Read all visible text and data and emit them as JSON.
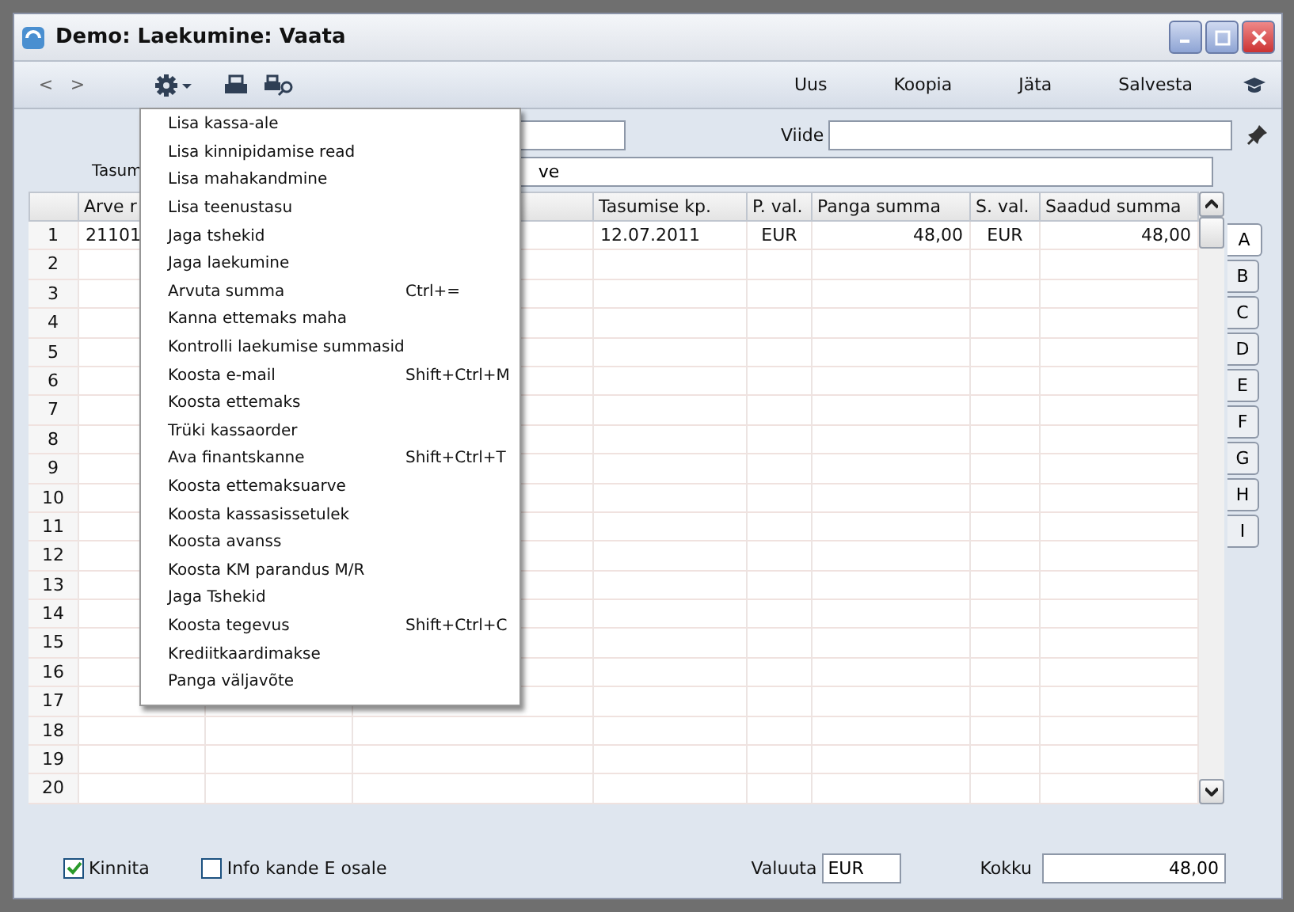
{
  "window": {
    "title": "Demo: Laekumine: Vaata"
  },
  "toolbar": {
    "nav": [
      "<",
      ">"
    ],
    "actions": [
      "Uus",
      "Koopia",
      "Jäta",
      "Salvesta"
    ]
  },
  "form": {
    "reference": {
      "label": "Viide"
    },
    "payment_label": "Tasum",
    "payment_field": {
      "value": "ve"
    }
  },
  "table": {
    "columns": [
      "",
      "Arve r",
      "",
      "",
      "Tasumise kp.",
      "P. val.",
      "Panga summa",
      "S. val.",
      "Saadud summa"
    ],
    "rows": [
      {
        "cells": [
          "1",
          "21101",
          "",
          "",
          "12.07.2011",
          "EUR",
          "48,00",
          "EUR",
          "48,00"
        ]
      },
      {
        "cells": [
          "2"
        ]
      },
      {
        "cells": [
          "3"
        ]
      },
      {
        "cells": [
          "4"
        ]
      },
      {
        "cells": [
          "5"
        ]
      },
      {
        "cells": [
          "6"
        ]
      },
      {
        "cells": [
          "7"
        ]
      },
      {
        "cells": [
          "8"
        ]
      },
      {
        "cells": [
          "9"
        ]
      },
      {
        "cells": [
          "10"
        ]
      },
      {
        "cells": [
          "11"
        ]
      },
      {
        "cells": [
          "12"
        ]
      },
      {
        "cells": [
          "13"
        ]
      },
      {
        "cells": [
          "14"
        ]
      },
      {
        "cells": [
          "15"
        ]
      },
      {
        "cells": [
          "16"
        ]
      },
      {
        "cells": [
          "17"
        ]
      },
      {
        "cells": [
          "18"
        ]
      },
      {
        "cells": [
          "19"
        ]
      },
      {
        "cells": [
          "20"
        ]
      }
    ]
  },
  "side_tabs": [
    {
      "label": "A",
      "selected": true
    },
    {
      "label": "B",
      "selected": false
    },
    {
      "label": "C",
      "selected": false
    },
    {
      "label": "D",
      "selected": false
    },
    {
      "label": "E",
      "selected": false
    },
    {
      "label": "F",
      "selected": false
    },
    {
      "label": "G",
      "selected": false
    },
    {
      "label": "H",
      "selected": false
    },
    {
      "label": "I",
      "selected": false
    }
  ],
  "menu": [
    {
      "label": "Lisa kassa-ale"
    },
    {
      "label": "Lisa kinnipidamise read"
    },
    {
      "label": "Lisa mahakandmine"
    },
    {
      "label": "Lisa teenustasu"
    },
    {
      "label": "Jaga tshekid"
    },
    {
      "label": "Jaga laekumine"
    },
    {
      "label": "Arvuta summa",
      "shortcut": "Ctrl+="
    },
    {
      "label": "Kanna ettemaks maha"
    },
    {
      "label": "Kontrolli laekumise summasid"
    },
    {
      "label": "Koosta e-mail",
      "shortcut": "Shift+Ctrl+M"
    },
    {
      "label": "Koosta ettemaks"
    },
    {
      "label": "Trüki kassaorder"
    },
    {
      "label": "Ava finantskanne",
      "shortcut": "Shift+Ctrl+T"
    },
    {
      "label": "Koosta ettemaksuarve"
    },
    {
      "label": "Koosta kassasissetulek"
    },
    {
      "label": "Koosta avanss"
    },
    {
      "label": "Koosta KM parandus M/R"
    },
    {
      "label": "Jaga Tshekid"
    },
    {
      "label": "Koosta tegevus",
      "shortcut": "Shift+Ctrl+C"
    },
    {
      "label": "Krediitkaardimakse"
    },
    {
      "label": "Panga väljavõte"
    }
  ],
  "footer": {
    "checkboxes": [
      {
        "label": "Kinnita",
        "checked": true
      },
      {
        "label": "Info kande E osale",
        "checked": false
      }
    ],
    "currency": {
      "label": "Valuuta",
      "value": "EUR"
    },
    "total": {
      "label": "Kokku",
      "value": "48,00"
    }
  }
}
